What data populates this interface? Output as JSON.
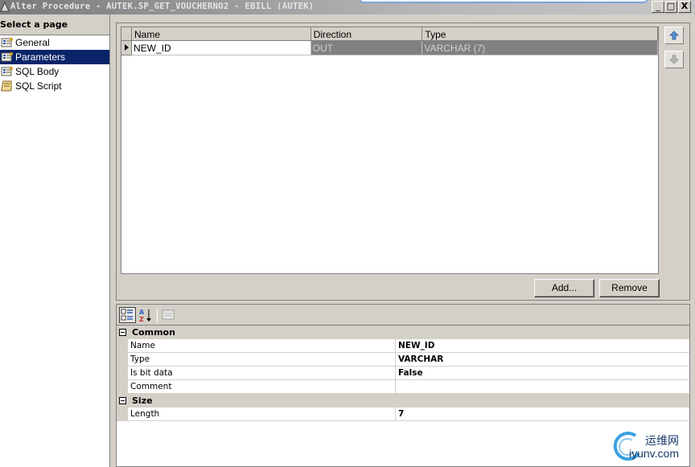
{
  "window": {
    "title": "Alter Procedure - AUTEK.SP_GET_VOUCHERNO2 - EBILL (AUTEK)",
    "minimize_glyph": "_",
    "maximize_glyph": "□",
    "close_glyph": "X"
  },
  "sidebar": {
    "header": "Select a page",
    "items": [
      {
        "label": "General",
        "icon": "page-properties-icon",
        "selected": false
      },
      {
        "label": "Parameters",
        "icon": "page-properties-icon",
        "selected": true
      },
      {
        "label": "SQL Body",
        "icon": "page-properties-icon",
        "selected": false
      },
      {
        "label": "SQL Script",
        "icon": "script-scroll-icon",
        "selected": false
      }
    ]
  },
  "parameters_grid": {
    "columns": [
      "Name",
      "Direction",
      "Type"
    ],
    "rows": [
      {
        "name": "NEW_ID",
        "direction": "OUT",
        "type": "VARCHAR (7)"
      }
    ],
    "add_label": "Add...",
    "remove_label": "Remove",
    "move_up_icon": "arrow-up-icon",
    "move_down_icon": "arrow-down-icon"
  },
  "property_grid": {
    "toolbar": [
      "categorized-icon",
      "alphabetical-icon",
      "property-pages-icon"
    ],
    "sections": [
      {
        "title": "Common",
        "rows": [
          {
            "name": "Name",
            "value": "NEW_ID"
          },
          {
            "name": "Type",
            "value": "VARCHAR"
          },
          {
            "name": "Is bit data",
            "value": "False"
          },
          {
            "name": "Comment",
            "value": ""
          }
        ]
      },
      {
        "title": "Size",
        "rows": [
          {
            "name": "Length",
            "value": "7"
          }
        ]
      }
    ]
  },
  "watermark": {
    "text_cn": "运维网",
    "text_en": "iyunv.com"
  },
  "colors": {
    "selection": "#0a246a",
    "panel": "#d4d0c8",
    "grid_selected_row": "#808080"
  }
}
